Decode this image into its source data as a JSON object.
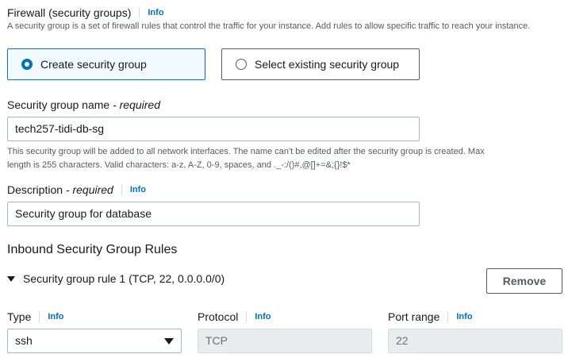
{
  "firewall": {
    "title": "Firewall (security groups)",
    "info": "Info",
    "description": "A security group is a set of firewall rules that control the traffic for your instance. Add rules to allow specific traffic to reach your instance.",
    "option_create": "Create security group",
    "option_select": "Select existing security group",
    "selected": "create"
  },
  "sg_name": {
    "label": "Security group name",
    "required": "- required",
    "value": "tech257-tidi-db-sg",
    "hint_line1": "This security group will be added to all network interfaces. The name can't be edited after the security group is created. Max",
    "hint_line2": "length is 255 characters. Valid characters: a-z, A-Z, 0-9, spaces, and ._-:/()#,@[]+=&;{}!$*"
  },
  "description": {
    "label": "Description",
    "required": "- required",
    "info": "Info",
    "value": "Security group for database"
  },
  "inbound": {
    "heading": "Inbound Security Group Rules",
    "rule_title": "Security group rule 1 (TCP, 22, 0.0.0.0/0)",
    "remove_label": "Remove",
    "type_label": "Type",
    "type_info": "Info",
    "type_value": "ssh",
    "protocol_label": "Protocol",
    "protocol_info": "Info",
    "protocol_value": "TCP",
    "port_label": "Port range",
    "port_info": "Info",
    "port_value": "22"
  },
  "colors": {
    "link": "#0073bb",
    "selected_bg": "#f1faff",
    "disabled_bg": "#eaeded"
  }
}
